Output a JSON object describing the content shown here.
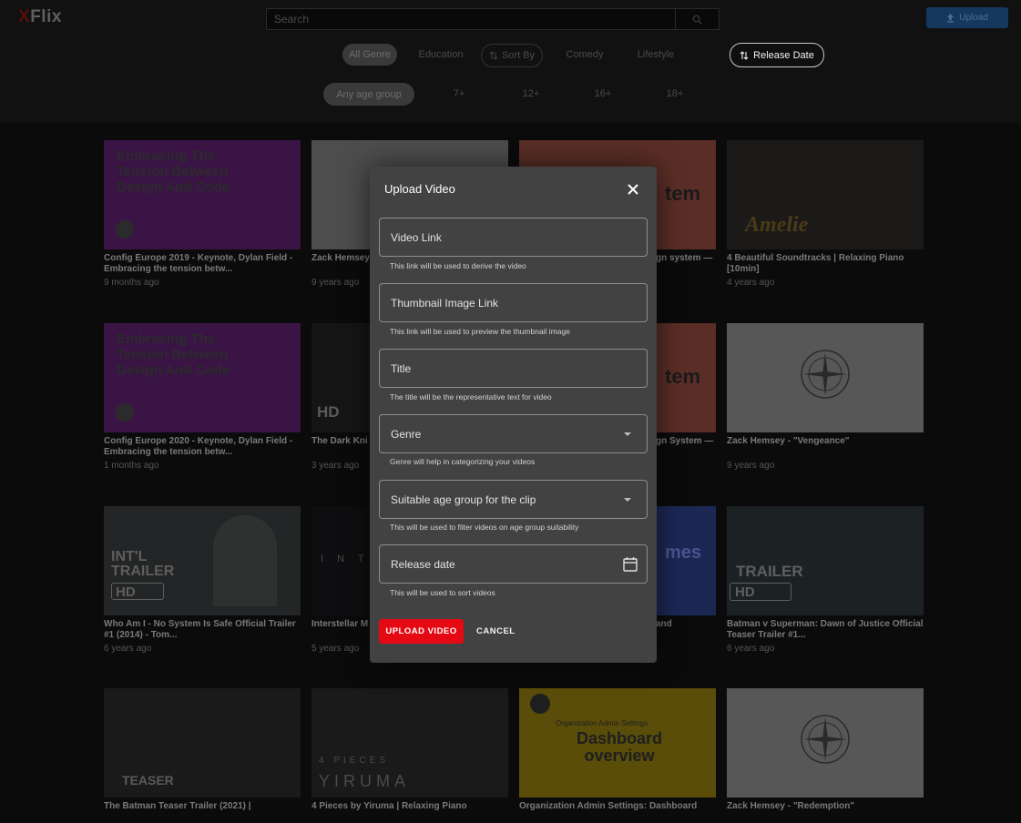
{
  "app": {
    "logo_x": "X",
    "logo_rest": "Flix"
  },
  "search": {
    "placeholder": "Search"
  },
  "header": {
    "upload_label": "Upload"
  },
  "genres": [
    "All Genre",
    "Education",
    "Sort By",
    "Comedy",
    "Lifestyle"
  ],
  "sort": {
    "release_label": "Release Date"
  },
  "ages": [
    "Any age group",
    "7+",
    "12+",
    "16+",
    "18+"
  ],
  "videos": [
    {
      "title": "Config Europe 2019 - Keynote, Dylan Field - Embracing the tension betw...",
      "date": "9 months ago",
      "thumb_text": "Embracing The Tension Between Design And Code"
    },
    {
      "title": "Zack Hemsey",
      "date": "9 years ago",
      "thumb_text": ""
    },
    {
      "title": "gn system —",
      "date": "",
      "thumb_text": "tem"
    },
    {
      "title": "4 Beautiful Soundtracks | Relaxing Piano [10min]",
      "date": "4 years ago",
      "thumb_text": "Amelie"
    },
    {
      "title": "Config Europe 2020 - Keynote, Dylan Field - Embracing the tension betw...",
      "date": "1 months ago",
      "thumb_text": "Embracing The Tension Between Design And Code"
    },
    {
      "title": "The Dark Kni Sacrifice Sce",
      "date": "3 years ago",
      "thumb_text": "HD"
    },
    {
      "title": "gn System —",
      "date": "",
      "thumb_text": "tem"
    },
    {
      "title": "Zack Hemsey - \"Vengeance\"",
      "date": "9 years ago",
      "thumb_text": ""
    },
    {
      "title": "Who Am I - No System Is Safe Official Trailer #1 (2014) - Tom...",
      "date": "6 years ago",
      "thumb_text": "INT'L TRAILER"
    },
    {
      "title": "Interstellar M Epic instrume",
      "date": "5 years ago",
      "thumb_text": "I N T E"
    },
    {
      "title": "and",
      "date": "",
      "thumb_text": "mes"
    },
    {
      "title": "Batman v Superman: Dawn of Justice Official Teaser Trailer #1...",
      "date": "6 years ago",
      "thumb_text": "TRAILER"
    },
    {
      "title": "The Batman Teaser Trailer (2021) |",
      "date": "",
      "thumb_text": "TEASER"
    },
    {
      "title": "4 Pieces by Yiruma | Relaxing Piano",
      "date": "",
      "thumb_text": "YIRUMA"
    },
    {
      "title": "Organization Admin Settings: Dashboard",
      "date": "",
      "thumb_text": "Dashboard overview"
    },
    {
      "title": "Zack Hemsey - \"Redemption\"",
      "date": "",
      "thumb_text": ""
    }
  ],
  "thumb_extras": {
    "four_pieces": "4 PIECES",
    "org_admin": "Organization Admin Settings",
    "hd": "HD"
  },
  "modal": {
    "title": "Upload Video",
    "fields": [
      {
        "placeholder": "Video Link",
        "helper": "This link will be used to derive the video"
      },
      {
        "placeholder": "Thumbnail Image Link",
        "helper": "This link will be used to preview the thumbnail image"
      },
      {
        "placeholder": "Title",
        "helper": "The title will be the representative text for video"
      },
      {
        "placeholder": "Genre",
        "helper": "Genre will help in categorizing your videos"
      },
      {
        "placeholder": "Suitable age group for the clip",
        "helper": "This will be used to filter videos on age group suitability"
      },
      {
        "placeholder": "Release date",
        "helper": "This will be used to sort videos"
      }
    ],
    "upload_label": "UPLOAD VIDEO",
    "cancel_label": "CANCEL"
  },
  "colors": {
    "accent": "#e50914",
    "modal_bg": "#424242",
    "page_bg": "#0b0b0b"
  },
  "icons": [
    "search-icon",
    "upload-icon",
    "sort-icon",
    "close-icon",
    "chevron-down-icon",
    "calendar-icon"
  ]
}
